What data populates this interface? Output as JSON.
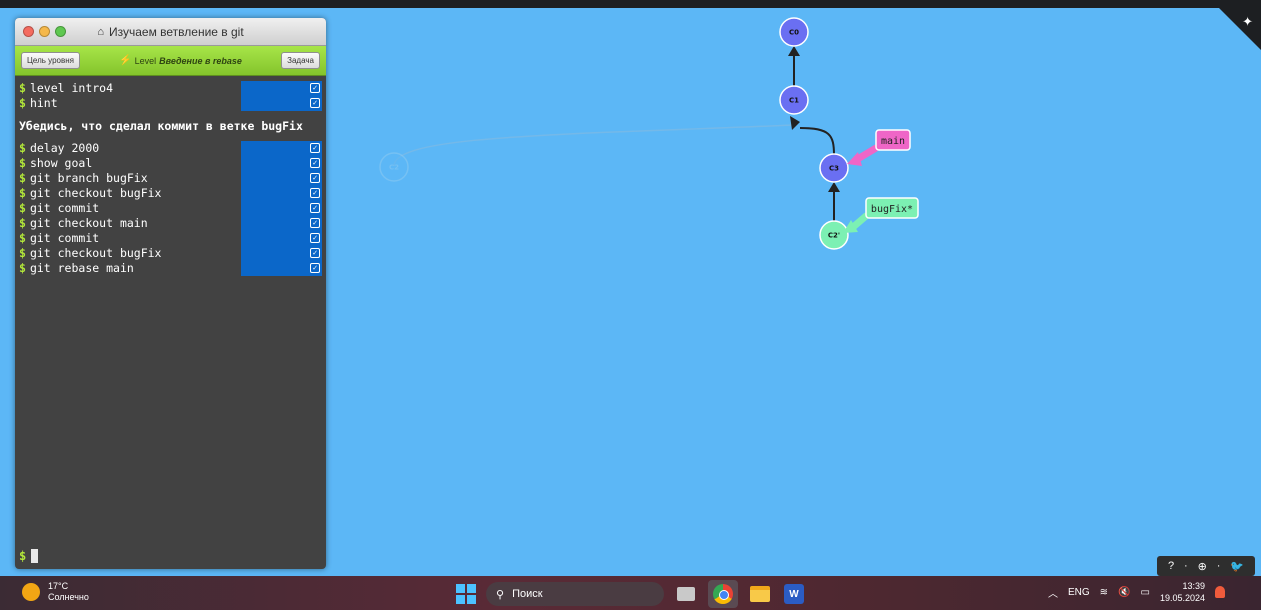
{
  "terminal": {
    "window_title": "Изучаем ветвление в git",
    "goal_button": "Цель уровня",
    "task_button": "Задача",
    "level_prefix": "Level",
    "level_name": "Введение в rebase",
    "commands_group1": [
      "level intro4",
      "hint"
    ],
    "message": "Убедись, что сделал коммит в ветке bugFix",
    "commands_group2": [
      "delay 2000",
      "show goal",
      "git branch bugFix",
      "git checkout bugFix",
      "git commit",
      "git checkout main",
      "git commit",
      "git checkout bugFix",
      "git rebase main"
    ],
    "prompt_symbol": "$"
  },
  "graph": {
    "nodes": [
      {
        "id": "C0",
        "label": "C0",
        "color": "#6a6ff2"
      },
      {
        "id": "C1",
        "label": "C1",
        "color": "#6a6ff2"
      },
      {
        "id": "C3",
        "label": "C3",
        "color": "#6a6ff2"
      },
      {
        "id": "C2'",
        "label": "C2'",
        "color": "#7cf0b3"
      },
      {
        "id": "C2",
        "label": "C2",
        "color": "#5cb7f6"
      }
    ],
    "branches": [
      {
        "name": "main",
        "color": "#ef66c7",
        "target": "C3"
      },
      {
        "name": "bugFix*",
        "color": "#7cf0b3",
        "target": "C2'"
      }
    ]
  },
  "helpbar": {
    "items": [
      "?",
      "·",
      "⊕",
      "·",
      "🐦"
    ]
  },
  "taskbar": {
    "temperature": "17°C",
    "weather": "Солнечно",
    "search_placeholder": "Поиск",
    "language": "ENG",
    "time": "13:39",
    "date": "19.05.2024"
  }
}
